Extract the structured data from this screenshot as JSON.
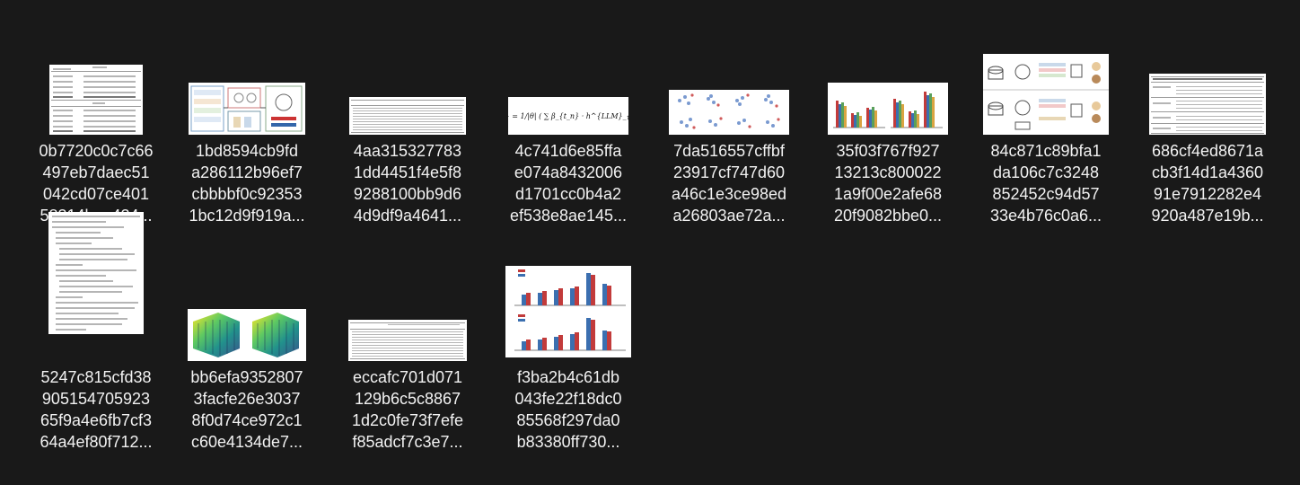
{
  "files": [
    {
      "name_lines": [
        "0b7720c0c7c66",
        "497eb7daec51",
        "042cd07ce401",
        "58314baa424..."
      ]
    },
    {
      "name_lines": [
        "1bd8594cb9fd",
        "a286112b96ef7",
        "cbbbbf0c92353",
        "1bc12d9f919a..."
      ]
    },
    {
      "name_lines": [
        "4aa315327783",
        "1dd4451f4e5f8",
        "9288100bb9d6",
        "4d9df9a4641..."
      ]
    },
    {
      "name_lines": [
        "4c741d6e85ffa",
        "e074a8432006",
        "d1701cc0b4a2",
        "ef538e8ae145..."
      ]
    },
    {
      "name_lines": [
        "7da516557cffbf",
        "23917cf747d60",
        "a46c1e3ce98ed",
        "a26803ae72a..."
      ]
    },
    {
      "name_lines": [
        "35f03f767f927",
        "13213c800022",
        "1a9f00e2afe68",
        "20f9082bbe0..."
      ]
    },
    {
      "name_lines": [
        "84c871c89bfa1",
        "da106c7c3248",
        "852452c94d57",
        "33e4b76c0a6..."
      ]
    },
    {
      "name_lines": [
        "686cf4ed8671a",
        "cb3f14d1a4360",
        "91e7912282e4",
        "920a487e19b..."
      ]
    },
    {
      "name_lines": [
        "5247c815cfd38",
        "905154705923",
        "65f9a4e6fb7cf3",
        "64a4ef80f712..."
      ]
    },
    {
      "name_lines": [
        "bb6efa9352807",
        "3facfe26e3037",
        "8f0d74ce972c1",
        "c60e4134de7..."
      ]
    },
    {
      "name_lines": [
        "eccafc701d071",
        "129b6c5c8867",
        "1d2c0fe73f7efe",
        "f85adcf7c3e7..."
      ]
    },
    {
      "name_lines": [
        "f3ba2b4c61db",
        "043fe22f18dc0",
        "85568f297da0",
        "b83380ff730..."
      ]
    }
  ],
  "thumbnail_text": {
    "equation": "z_{v_t} = 1/|θ| ( ∑ β_{t_n} · h^{LLM}_{t_n} ),"
  },
  "colors": {
    "background": "#191919",
    "filename_text": "#f2f2f2",
    "bar_blue": "#3b6fb0",
    "bar_red": "#c23b3b"
  }
}
